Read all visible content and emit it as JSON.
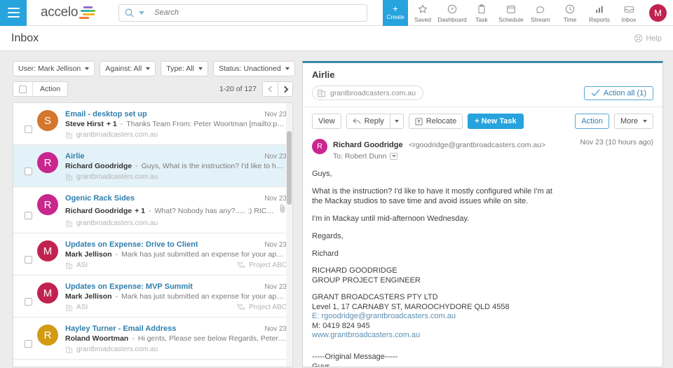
{
  "topnav": {
    "menu_icon": "hamburger-icon",
    "brand": "accelo",
    "search": {
      "placeholder": "Search",
      "value": "",
      "icon": "search-icon"
    },
    "create": {
      "label": "Create",
      "plus": "+"
    },
    "items": [
      {
        "label": "Saved",
        "icon": "star-icon"
      },
      {
        "label": "Dashboard",
        "icon": "gauge-icon"
      },
      {
        "label": "Task",
        "icon": "clipboard-icon"
      },
      {
        "label": "Schedule",
        "icon": "calendar-icon"
      },
      {
        "label": "Stream",
        "icon": "chat-icon"
      },
      {
        "label": "Time",
        "icon": "clock-icon"
      },
      {
        "label": "Reports",
        "icon": "bar-chart-icon"
      },
      {
        "label": "Inbox",
        "icon": "inbox-icon"
      }
    ],
    "avatar": {
      "initial": "M",
      "color": "#c1224f"
    }
  },
  "pagehead": {
    "title": "Inbox",
    "help_label": "Help",
    "help_icon": "lifebuoy-icon"
  },
  "filters": [
    {
      "label": "User: Mark Jellison"
    },
    {
      "label": "Against: All"
    },
    {
      "label": "Type: All"
    },
    {
      "label": "Status: Unactioned"
    }
  ],
  "list_toolbar": {
    "select_all_checked": false,
    "action_label": "Action",
    "pager_count": "1-20 of 127",
    "prev_icon": "chevron-left-icon",
    "next_icon": "chevron-right-icon"
  },
  "messages": [
    {
      "subject": "Email - desktop set up",
      "date": "Nov 23",
      "sender": "Steve Hirst",
      "plus": "+ 1",
      "preview": "Thanks Team From: Peter Woortman [mailto:pwoortma...",
      "company": "grantbroadcasters.com.au",
      "project": "",
      "avatar": {
        "initial": "S",
        "color": "#d4762c"
      },
      "selected": false,
      "attachment": false
    },
    {
      "subject": "Airlie",
      "date": "Nov 23",
      "sender": "Richard Goodridge",
      "plus": "",
      "preview": "Guys, What is the instruction? I'd like to have it mostl...",
      "company": "grantbroadcasters.com.au",
      "project": "",
      "avatar": {
        "initial": "R",
        "color": "#c9268e"
      },
      "selected": true,
      "attachment": false
    },
    {
      "subject": "Ogenic Rack Sides",
      "date": "Nov 23",
      "sender": "Richard Goodridge",
      "plus": "+ 1",
      "preview": "What? Nobody has any?..... :) RICHARD GOOD...",
      "company": "grantbroadcasters.com.au",
      "project": "",
      "avatar": {
        "initial": "R",
        "color": "#c9268e"
      },
      "selected": false,
      "attachment": true
    },
    {
      "subject": "Updates on Expense: Drive to Client",
      "date": "Nov 23",
      "sender": "Mark Jellison",
      "plus": "",
      "preview": "Mark has just submitted an expense for your approval: Tit...",
      "company": "ASI",
      "project": "Project ABC",
      "avatar": {
        "initial": "M",
        "color": "#c1224f"
      },
      "selected": false,
      "attachment": false
    },
    {
      "subject": "Updates on Expense: MVP Summit",
      "date": "Nov 23",
      "sender": "Mark Jellison",
      "plus": "",
      "preview": "Mark has just submitted an expense for your approval: Tit...",
      "company": "ASI",
      "project": "Project ABC",
      "avatar": {
        "initial": "M",
        "color": "#c1224f"
      },
      "selected": false,
      "attachment": false
    },
    {
      "subject": "Hayley Turner - Email Address",
      "date": "Nov 23",
      "sender": "Roland Woortman",
      "plus": "",
      "preview": "Hi gents, Please see below Regards,  Peter Woortman...",
      "company": "grantbroadcasters.com.au",
      "project": "",
      "avatar": {
        "initial": "R",
        "color": "#d29b13"
      },
      "selected": false,
      "attachment": false
    }
  ],
  "detail": {
    "title": "Airlie",
    "company": "grantbroadcasters.com.au",
    "action_all_label": "Action all (1)",
    "toolbar": {
      "view_label": "View",
      "reply_label": "Reply",
      "relocate_label": "Relocate",
      "new_task_label": "+ New Task",
      "action_label": "Action",
      "more_label": "More"
    },
    "message": {
      "avatar": {
        "initial": "R",
        "color": "#c9268e"
      },
      "from_name": "Richard Goodridge",
      "from_email": "<rgoodridge@grantbroadcasters.com.au>",
      "to_label": "To: Robert Dunn",
      "date": "Nov 23 (10 hours ago)",
      "greeting": "Guys,",
      "para1_line1": "What is the instruction? I'd like to have it mostly configured while I'm at",
      "para1_line2": "the Mackay studios to save time and avoid issues while on site.",
      "para2": "I'm in Mackay until mid-afternoon Wednesday.",
      "regards": "Regards,",
      "name": "Richard",
      "sig_name": "RICHARD GOODRIDGE",
      "sig_title": "GROUP PROJECT ENGINEER",
      "sig_company": "GRANT BROADCASTERS PTY LTD",
      "sig_address": "Level 1, 17 CARNABY ST, MAROOCHYDORE QLD 4558",
      "sig_email": "E: rgoodridge@grantbroadcasters.com.au",
      "sig_mobile": "M: 0419 824 945",
      "sig_web": "www.grantbroadcasters.com.au",
      "orig_divider": "-----Original Message-----",
      "orig_line1": "Guys,"
    }
  }
}
